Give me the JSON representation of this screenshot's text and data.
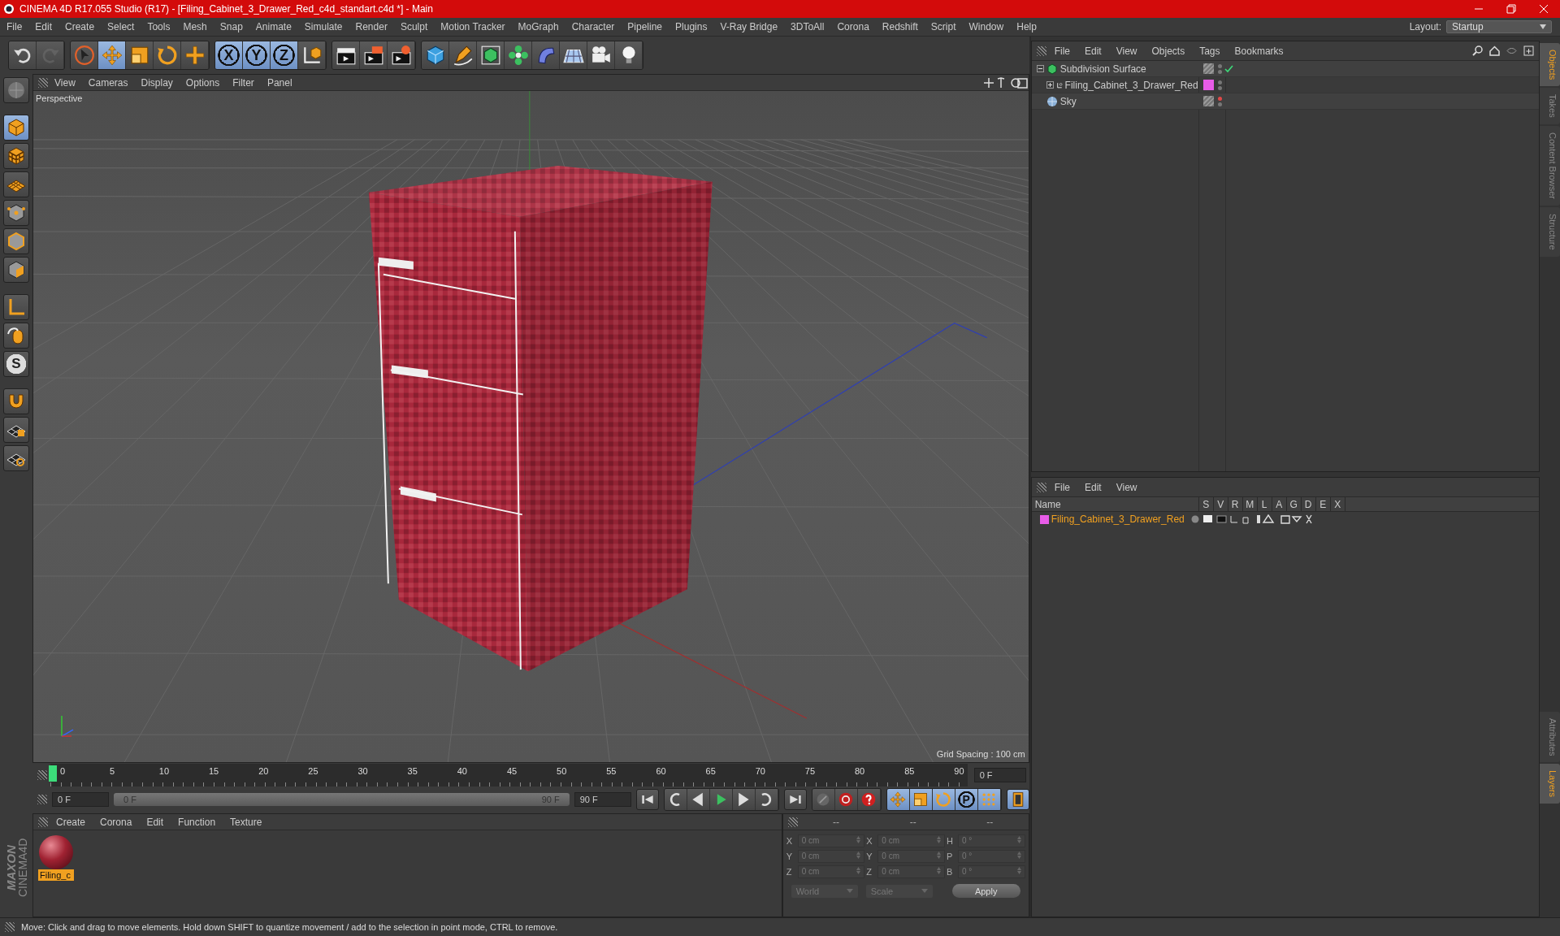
{
  "window": {
    "title": "CINEMA 4D R17.055 Studio (R17) - [Filing_Cabinet_3_Drawer_Red_c4d_standart.c4d *] - Main"
  },
  "menu": [
    "File",
    "Edit",
    "Create",
    "Select",
    "Tools",
    "Mesh",
    "Snap",
    "Animate",
    "Simulate",
    "Render",
    "Sculpt",
    "Motion Tracker",
    "MoGraph",
    "Character",
    "Pipeline",
    "Plugins",
    "V-Ray Bridge",
    "3DToAll",
    "Corona",
    "Redshift",
    "Script",
    "Window",
    "Help"
  ],
  "layout": {
    "label": "Layout:",
    "value": "Startup"
  },
  "toolbar": {
    "groups": [
      {
        "buttons": [
          {
            "kind": "undo",
            "selected": false,
            "disabled": false
          },
          {
            "kind": "redo",
            "selected": false,
            "disabled": true
          }
        ]
      },
      {
        "buttons": [
          {
            "kind": "select",
            "selected": false,
            "disabled": false
          },
          {
            "kind": "move",
            "selected": true,
            "disabled": false
          },
          {
            "kind": "scale",
            "selected": false,
            "disabled": false
          },
          {
            "kind": "rotate",
            "selected": false,
            "disabled": false
          },
          {
            "kind": "add",
            "selected": false,
            "disabled": false
          }
        ]
      },
      {
        "buttons": [
          {
            "kind": "axis",
            "label": "X",
            "selected": true,
            "disabled": false
          },
          {
            "kind": "axis",
            "label": "Y",
            "selected": true,
            "disabled": false
          },
          {
            "kind": "axis",
            "label": "Z",
            "selected": true,
            "disabled": false
          },
          {
            "kind": "coord",
            "selected": false,
            "disabled": false
          }
        ]
      },
      {
        "buttons": [
          {
            "kind": "render-view",
            "selected": false,
            "disabled": false
          },
          {
            "kind": "render-picture",
            "selected": false,
            "disabled": false
          },
          {
            "kind": "render-settings",
            "selected": false,
            "disabled": false
          }
        ]
      },
      {
        "buttons": [
          {
            "kind": "cube",
            "selected": false,
            "disabled": false
          },
          {
            "kind": "pen",
            "selected": false,
            "disabled": false
          },
          {
            "kind": "subdivision",
            "selected": false,
            "disabled": false
          },
          {
            "kind": "cloner",
            "selected": false,
            "disabled": false
          },
          {
            "kind": "deformer",
            "selected": false,
            "disabled": false
          },
          {
            "kind": "floor",
            "selected": false,
            "disabled": false
          },
          {
            "kind": "camera",
            "selected": false,
            "disabled": false
          },
          {
            "kind": "light",
            "selected": false,
            "disabled": false
          }
        ]
      }
    ]
  },
  "left_toolbar": {
    "buttons": [
      {
        "kind": "editable",
        "selected": false
      },
      {
        "kind": "model",
        "selected": true
      },
      {
        "kind": "texture",
        "selected": false
      },
      {
        "kind": "workplane",
        "selected": false
      },
      {
        "kind": "points",
        "selected": false
      },
      {
        "kind": "edges",
        "selected": false
      },
      {
        "kind": "polygons",
        "selected": false
      },
      {
        "kind": "axis-mode",
        "selected": false
      },
      {
        "kind": "tweak",
        "selected": false
      },
      {
        "kind": "snap",
        "label": "S",
        "selected": false
      },
      {
        "kind": "magnet",
        "selected": false
      },
      {
        "kind": "grid-lock",
        "selected": false
      },
      {
        "kind": "grid-rotate",
        "selected": false
      }
    ]
  },
  "viewport": {
    "menu": [
      "View",
      "Cameras",
      "Display",
      "Options",
      "Filter",
      "Panel"
    ],
    "camera": "Perspective",
    "grid_spacing": "Grid Spacing : 100 cm"
  },
  "timeline": {
    "ticks": [
      "0",
      "5",
      "10",
      "15",
      "20",
      "25",
      "30",
      "35",
      "40",
      "45",
      "50",
      "55",
      "60",
      "65",
      "70",
      "75",
      "80",
      "85",
      "90"
    ],
    "playhead": {
      "level": 0
    },
    "current": "0 F",
    "start": "0 F",
    "range": {
      "start": "0 F",
      "end": "90 F",
      "level": 1
    },
    "end": "90 F",
    "buttons": [
      {
        "kind": "first",
        "selected": false
      },
      {
        "kind": "prev-key",
        "selected": false
      },
      {
        "kind": "prev-frame",
        "selected": false
      },
      {
        "kind": "play",
        "selected": false
      },
      {
        "kind": "next-frame",
        "selected": false
      },
      {
        "kind": "next-key",
        "selected": false
      },
      {
        "kind": "last",
        "selected": false
      },
      {
        "kind": "key-off",
        "selected": false
      },
      {
        "kind": "record",
        "selected": false
      },
      {
        "kind": "autokey",
        "selected": false
      },
      {
        "kind": "move",
        "selected": true
      },
      {
        "kind": "scale",
        "selected": true
      },
      {
        "kind": "rotate",
        "selected": true
      },
      {
        "kind": "param",
        "label": "P",
        "selected": true
      },
      {
        "kind": "points-grid",
        "selected": true
      },
      {
        "kind": "film",
        "selected": true
      }
    ]
  },
  "materials": {
    "menu": [
      "Create",
      "Corona",
      "Edit",
      "Function",
      "Texture"
    ],
    "items": [
      {
        "name": "Filing_c",
        "selected": true
      }
    ]
  },
  "logo": {
    "brand": "MAXON",
    "product": "CINEMA4D"
  },
  "coordinates": {
    "headers": [
      "--",
      "--",
      "--"
    ],
    "rows": [
      {
        "axis": "X",
        "position": "0 cm",
        "size_axis": "X",
        "size": "0 cm",
        "rot_axis": "H",
        "rotation": "0 °"
      },
      {
        "axis": "Y",
        "position": "0 cm",
        "size_axis": "Y",
        "size": "0 cm",
        "rot_axis": "P",
        "rotation": "0 °"
      },
      {
        "axis": "Z",
        "position": "0 cm",
        "size_axis": "Z",
        "size": "0 cm",
        "rot_axis": "B",
        "rotation": "0 °"
      }
    ],
    "mode": "World",
    "size_mode": "Scale",
    "apply": "Apply"
  },
  "objects": {
    "menu": [
      "File",
      "Edit",
      "View",
      "Objects",
      "Tags",
      "Bookmarks"
    ],
    "tree": [
      {
        "name": "Subdivision Surface",
        "kind": "subdivision",
        "expanded": true,
        "checked": true,
        "hidden": false,
        "children": [
          {
            "name": "Filing_Cabinet_3_Drawer_Red",
            "kind": "null",
            "expanded": false,
            "checked": false,
            "hidden": false,
            "color": "#e85ce8"
          }
        ]
      },
      {
        "name": "Sky",
        "kind": "sky",
        "checked": false,
        "hidden": true
      }
    ]
  },
  "layers": {
    "menu": [
      "File",
      "Edit",
      "View"
    ],
    "columns": [
      "Name",
      "S",
      "V",
      "R",
      "M",
      "L",
      "A",
      "G",
      "D",
      "E",
      "X"
    ],
    "rows": [
      {
        "name": "Filing_Cabinet_3_Drawer_Red",
        "color": "#e85ce8"
      }
    ]
  },
  "side_tabs": {
    "top": [
      {
        "label": "Objects",
        "selected": true
      },
      {
        "label": "Takes",
        "selected": false
      },
      {
        "label": "Content Browser",
        "selected": false
      },
      {
        "label": "Structure",
        "selected": false
      }
    ],
    "bottom": [
      {
        "label": "Attributes",
        "selected": false
      },
      {
        "label": "Layers",
        "selected": true
      }
    ]
  },
  "status_bar": {
    "text": "Move: Click and drag to move elements. Hold down SHIFT to quantize movement / add to the selection in point mode, CTRL to remove."
  }
}
